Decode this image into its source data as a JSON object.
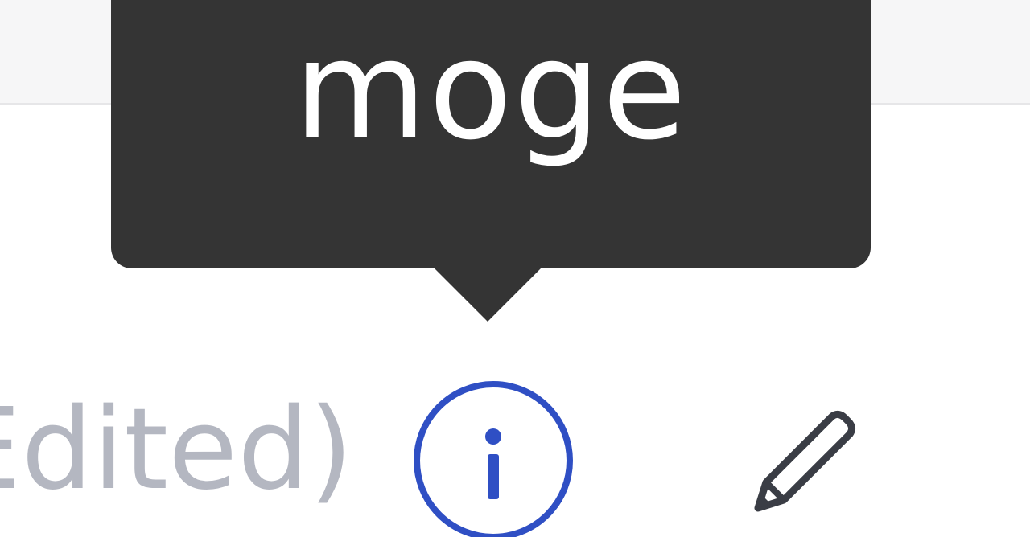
{
  "tooltip": {
    "text": "moge"
  },
  "comment": {
    "edited_label": "Edited)"
  },
  "icons": {
    "info": "info-circle-icon",
    "edit": "pencil-icon"
  },
  "colors": {
    "tooltip_bg": "#343434",
    "tooltip_text": "#ffffff",
    "info_accent": "#2f4fc4",
    "muted_text": "#b4b7c1",
    "pencil": "#3a3d45"
  }
}
